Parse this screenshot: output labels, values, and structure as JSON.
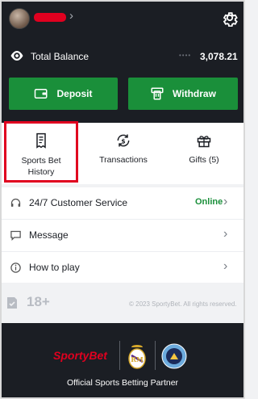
{
  "header": {
    "balance_label": "Total Balance",
    "balance_value": "3,078.21",
    "masked_dots": "••••"
  },
  "wallet": {
    "deposit_label": "Deposit",
    "withdraw_label": "Withdraw"
  },
  "actions": [
    {
      "label": "Sports Bet History"
    },
    {
      "label": "Transactions"
    },
    {
      "label": "Gifts (5)"
    }
  ],
  "menu": [
    {
      "label": "24/7 Customer Service",
      "status": "Online",
      "icon": "headset-icon"
    },
    {
      "label": "Message",
      "status": "",
      "icon": "message-icon"
    },
    {
      "label": "How to play",
      "status": "",
      "icon": "info-icon"
    }
  ],
  "footer": {
    "age_badge": "18+",
    "copyright": "© 2023 SportyBet. All rights reserved."
  },
  "partner": {
    "brand": "SportyBet",
    "text": "Official Sports Betting Partner"
  },
  "colors": {
    "accent_green": "#1a8f3a",
    "brand_red": "#e0001f",
    "header_bg": "#1b1e24"
  }
}
